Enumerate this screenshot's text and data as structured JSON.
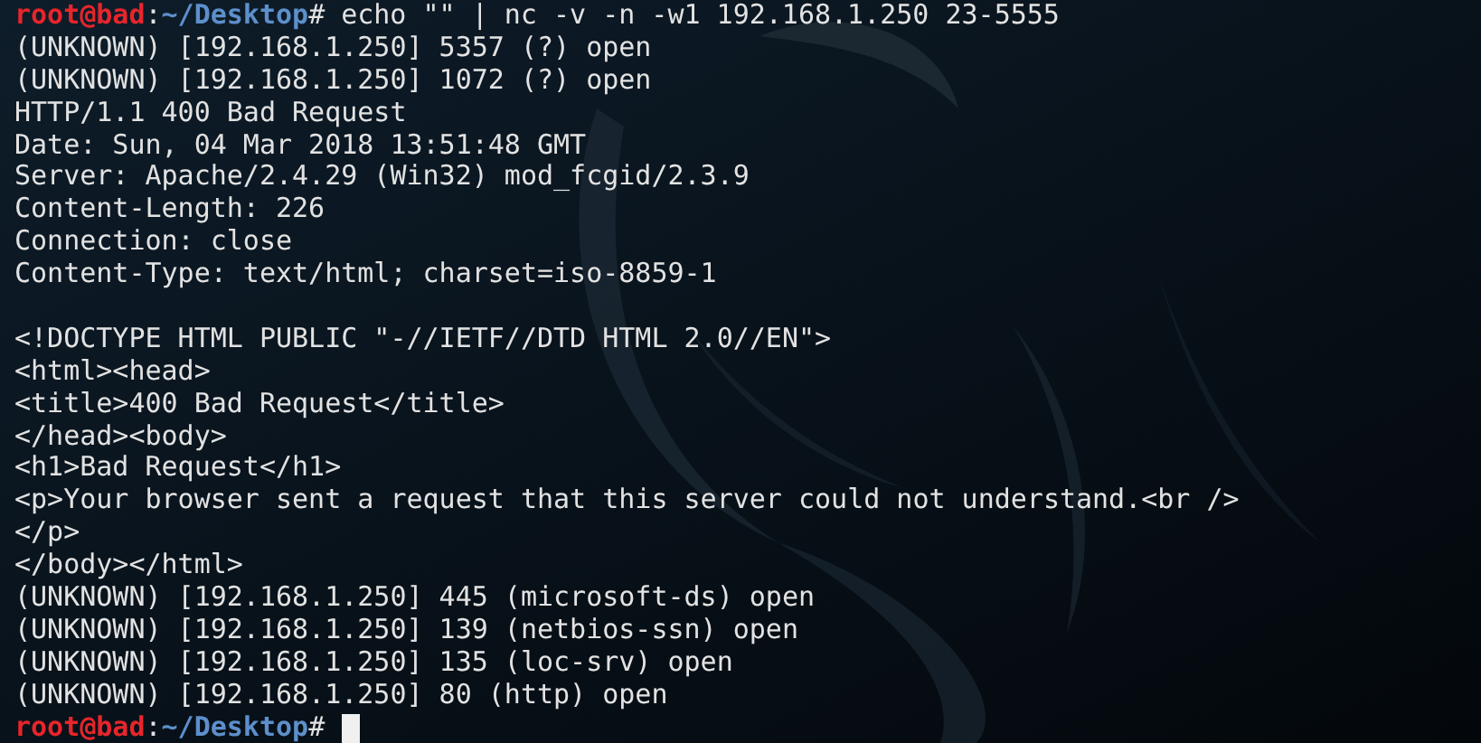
{
  "terminal": {
    "lines": [
      {
        "kind": "prompt",
        "user_host": "root@bad",
        "separator": ":",
        "path": "~/Desktop",
        "symbol": "#",
        "command": "echo \"\" | nc -v -n -w1 192.168.1.250 23-5555"
      },
      {
        "kind": "output",
        "text": "(UNKNOWN) [192.168.1.250] 5357 (?) open"
      },
      {
        "kind": "output",
        "text": "(UNKNOWN) [192.168.1.250] 1072 (?) open"
      },
      {
        "kind": "output",
        "text": "HTTP/1.1 400 Bad Request"
      },
      {
        "kind": "output",
        "text": "Date: Sun, 04 Mar 2018 13:51:48 GMT"
      },
      {
        "kind": "output",
        "text": "Server: Apache/2.4.29 (Win32) mod_fcgid/2.3.9"
      },
      {
        "kind": "output",
        "text": "Content-Length: 226"
      },
      {
        "kind": "output",
        "text": "Connection: close"
      },
      {
        "kind": "output",
        "text": "Content-Type: text/html; charset=iso-8859-1"
      },
      {
        "kind": "blank"
      },
      {
        "kind": "output",
        "text": "<!DOCTYPE HTML PUBLIC \"-//IETF//DTD HTML 2.0//EN\">"
      },
      {
        "kind": "output",
        "text": "<html><head>"
      },
      {
        "kind": "output",
        "text": "<title>400 Bad Request</title>"
      },
      {
        "kind": "output",
        "text": "</head><body>"
      },
      {
        "kind": "output",
        "text": "<h1>Bad Request</h1>"
      },
      {
        "kind": "output",
        "text": "<p>Your browser sent a request that this server could not understand.<br />"
      },
      {
        "kind": "output",
        "text": "</p>"
      },
      {
        "kind": "output",
        "text": "</body></html>"
      },
      {
        "kind": "output",
        "text": "(UNKNOWN) [192.168.1.250] 445 (microsoft-ds) open"
      },
      {
        "kind": "output",
        "text": "(UNKNOWN) [192.168.1.250] 139 (netbios-ssn) open"
      },
      {
        "kind": "output",
        "text": "(UNKNOWN) [192.168.1.250] 135 (loc-srv) open"
      },
      {
        "kind": "output",
        "text": "(UNKNOWN) [192.168.1.250] 80 (http) open"
      },
      {
        "kind": "prompt",
        "user_host": "root@bad",
        "separator": ":",
        "path": "~/Desktop",
        "symbol": "#",
        "cursor": true
      }
    ]
  }
}
